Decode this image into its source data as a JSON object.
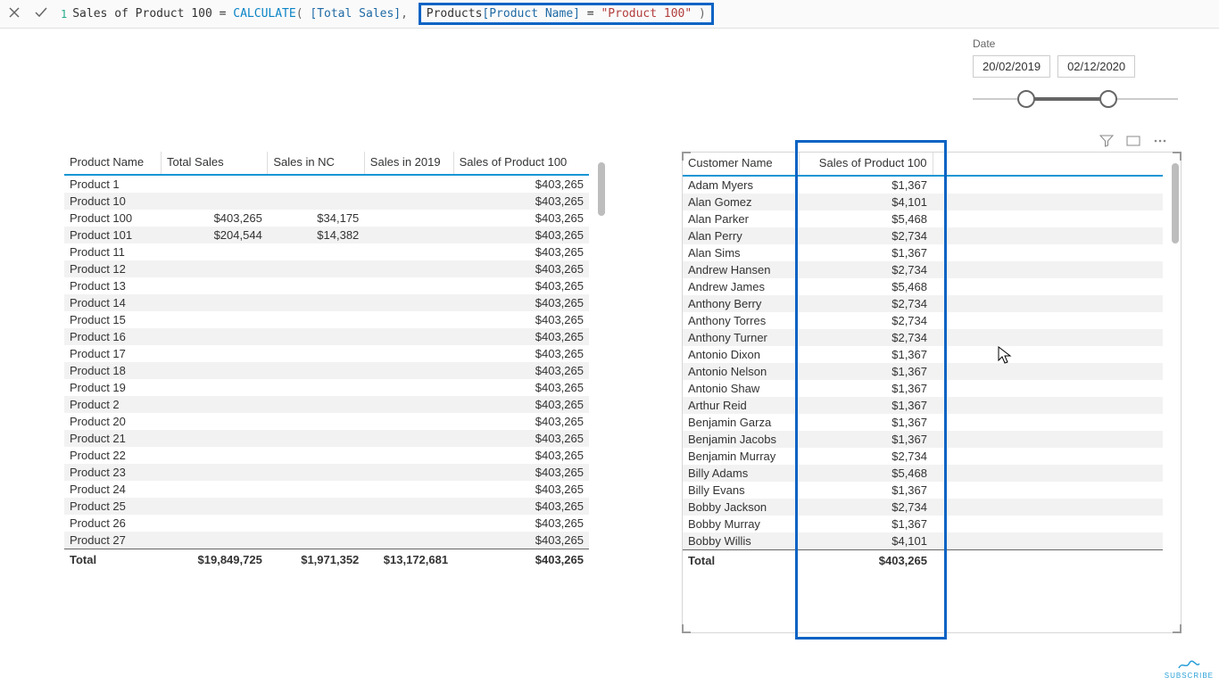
{
  "formula": {
    "line_no": "1",
    "measure_name": "Sales of Product 100",
    "equals": " = ",
    "func": "CALCULATE",
    "open": "(",
    "arg1_open": " [",
    "arg1": "Total Sales",
    "arg1_close": "]",
    "comma": ", ",
    "filter_table": "Products",
    "filter_open": "[",
    "filter_col": "Product Name",
    "filter_close": "]",
    "eq": " = ",
    "filter_val": "\"Product 100\"",
    "close": " )"
  },
  "date_slicer": {
    "label": "Date",
    "from": "20/02/2019",
    "to": "02/12/2020"
  },
  "table1": {
    "headers": [
      "Product Name",
      "Total Sales",
      "Sales in NC",
      "Sales in 2019",
      "Sales of Product 100"
    ],
    "rows": [
      {
        "name": "Product 1",
        "ts": "",
        "nc": "",
        "y19": "",
        "p100": "$403,265"
      },
      {
        "name": "Product 10",
        "ts": "",
        "nc": "",
        "y19": "",
        "p100": "$403,265"
      },
      {
        "name": "Product 100",
        "ts": "$403,265",
        "nc": "$34,175",
        "y19": "",
        "p100": "$403,265"
      },
      {
        "name": "Product 101",
        "ts": "$204,544",
        "nc": "$14,382",
        "y19": "",
        "p100": "$403,265"
      },
      {
        "name": "Product 11",
        "ts": "",
        "nc": "",
        "y19": "",
        "p100": "$403,265"
      },
      {
        "name": "Product 12",
        "ts": "",
        "nc": "",
        "y19": "",
        "p100": "$403,265"
      },
      {
        "name": "Product 13",
        "ts": "",
        "nc": "",
        "y19": "",
        "p100": "$403,265"
      },
      {
        "name": "Product 14",
        "ts": "",
        "nc": "",
        "y19": "",
        "p100": "$403,265"
      },
      {
        "name": "Product 15",
        "ts": "",
        "nc": "",
        "y19": "",
        "p100": "$403,265"
      },
      {
        "name": "Product 16",
        "ts": "",
        "nc": "",
        "y19": "",
        "p100": "$403,265"
      },
      {
        "name": "Product 17",
        "ts": "",
        "nc": "",
        "y19": "",
        "p100": "$403,265"
      },
      {
        "name": "Product 18",
        "ts": "",
        "nc": "",
        "y19": "",
        "p100": "$403,265"
      },
      {
        "name": "Product 19",
        "ts": "",
        "nc": "",
        "y19": "",
        "p100": "$403,265"
      },
      {
        "name": "Product 2",
        "ts": "",
        "nc": "",
        "y19": "",
        "p100": "$403,265"
      },
      {
        "name": "Product 20",
        "ts": "",
        "nc": "",
        "y19": "",
        "p100": "$403,265"
      },
      {
        "name": "Product 21",
        "ts": "",
        "nc": "",
        "y19": "",
        "p100": "$403,265"
      },
      {
        "name": "Product 22",
        "ts": "",
        "nc": "",
        "y19": "",
        "p100": "$403,265"
      },
      {
        "name": "Product 23",
        "ts": "",
        "nc": "",
        "y19": "",
        "p100": "$403,265"
      },
      {
        "name": "Product 24",
        "ts": "",
        "nc": "",
        "y19": "",
        "p100": "$403,265"
      },
      {
        "name": "Product 25",
        "ts": "",
        "nc": "",
        "y19": "",
        "p100": "$403,265"
      },
      {
        "name": "Product 26",
        "ts": "",
        "nc": "",
        "y19": "",
        "p100": "$403,265"
      },
      {
        "name": "Product 27",
        "ts": "",
        "nc": "",
        "y19": "",
        "p100": "$403,265"
      }
    ],
    "total_label": "Total",
    "totals": {
      "ts": "$19,849,725",
      "nc": "$1,971,352",
      "y19": "$13,172,681",
      "p100": "$403,265"
    }
  },
  "table2": {
    "headers": [
      "Customer Name",
      "Sales of Product 100"
    ],
    "rows": [
      {
        "name": "Adam Myers",
        "v": "$1,367"
      },
      {
        "name": "Alan Gomez",
        "v": "$4,101"
      },
      {
        "name": "Alan Parker",
        "v": "$5,468"
      },
      {
        "name": "Alan Perry",
        "v": "$2,734"
      },
      {
        "name": "Alan Sims",
        "v": "$1,367"
      },
      {
        "name": "Andrew Hansen",
        "v": "$2,734"
      },
      {
        "name": "Andrew James",
        "v": "$5,468"
      },
      {
        "name": "Anthony Berry",
        "v": "$2,734"
      },
      {
        "name": "Anthony Torres",
        "v": "$2,734"
      },
      {
        "name": "Anthony Turner",
        "v": "$2,734"
      },
      {
        "name": "Antonio Dixon",
        "v": "$1,367"
      },
      {
        "name": "Antonio Nelson",
        "v": "$1,367"
      },
      {
        "name": "Antonio Shaw",
        "v": "$1,367"
      },
      {
        "name": "Arthur Reid",
        "v": "$1,367"
      },
      {
        "name": "Benjamin Garza",
        "v": "$1,367"
      },
      {
        "name": "Benjamin Jacobs",
        "v": "$1,367"
      },
      {
        "name": "Benjamin Murray",
        "v": "$2,734"
      },
      {
        "name": "Billy Adams",
        "v": "$5,468"
      },
      {
        "name": "Billy Evans",
        "v": "$1,367"
      },
      {
        "name": "Bobby Jackson",
        "v": "$2,734"
      },
      {
        "name": "Bobby Murray",
        "v": "$1,367"
      },
      {
        "name": "Bobby Willis",
        "v": "$4,101"
      }
    ],
    "total_label": "Total",
    "total": "$403,265"
  },
  "subscribe": "SUBSCRIBE"
}
